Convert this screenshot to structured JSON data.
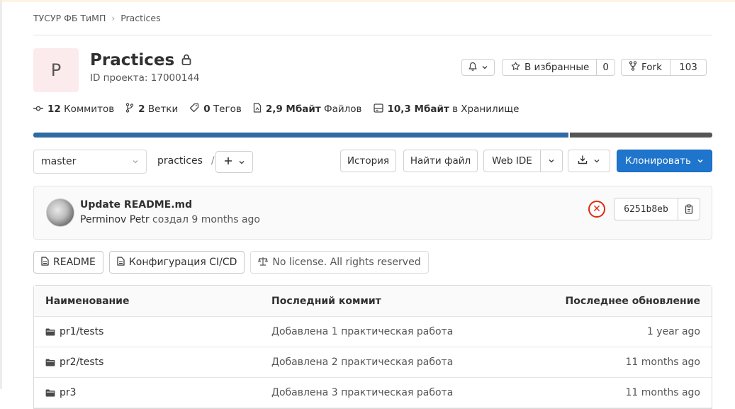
{
  "breadcrumb": {
    "group": "ТУСУР ФБ ТиМП",
    "project": "Practices"
  },
  "project": {
    "avatar_letter": "P",
    "name": "Practices",
    "id_label": "ID проекта: 17000144"
  },
  "actions": {
    "star_label": "В избранные",
    "star_count": "0",
    "fork_label": "Fork",
    "fork_count": "103"
  },
  "stats": {
    "commits_num": "12",
    "commits_label": "Коммитов",
    "branches_num": "2",
    "branches_label": "Ветки",
    "tags_num": "0",
    "tags_label": "Тегов",
    "files_size": "2,9 Мбайт",
    "files_label": "Файлов",
    "storage_size": "10,3 Мбайт",
    "storage_label": "в Хранилище"
  },
  "languages": [
    {
      "color": "#2f6aa4",
      "fraction": 0.79
    },
    {
      "color": "#555555",
      "fraction": 0.21
    }
  ],
  "toolbar": {
    "branch": "master",
    "path": "practices",
    "path_sep": "/",
    "history": "История",
    "find_file": "Найти файл",
    "web_ide": "Web IDE",
    "clone": "Клонировать"
  },
  "last_commit": {
    "title": "Update README.md",
    "author": "Perminov Petr",
    "action": "создал",
    "time": "9 months ago",
    "sha": "6251b8eb"
  },
  "badges": {
    "readme": "README",
    "ci": "Конфигурация CI/CD",
    "license": "No license. All rights reserved"
  },
  "table": {
    "headers": {
      "name": "Наименование",
      "commit": "Последний коммит",
      "updated": "Последнее обновление"
    },
    "rows": [
      {
        "name": "pr1/tests",
        "commit": "Добавлена 1 практическая работа",
        "updated": "1 year ago"
      },
      {
        "name": "pr2/tests",
        "commit": "Добавлена 2 практическая работа",
        "updated": "11 months ago"
      },
      {
        "name": "pr3",
        "commit": "Добавлена 3 практическая работа",
        "updated": "11 months ago"
      }
    ]
  }
}
